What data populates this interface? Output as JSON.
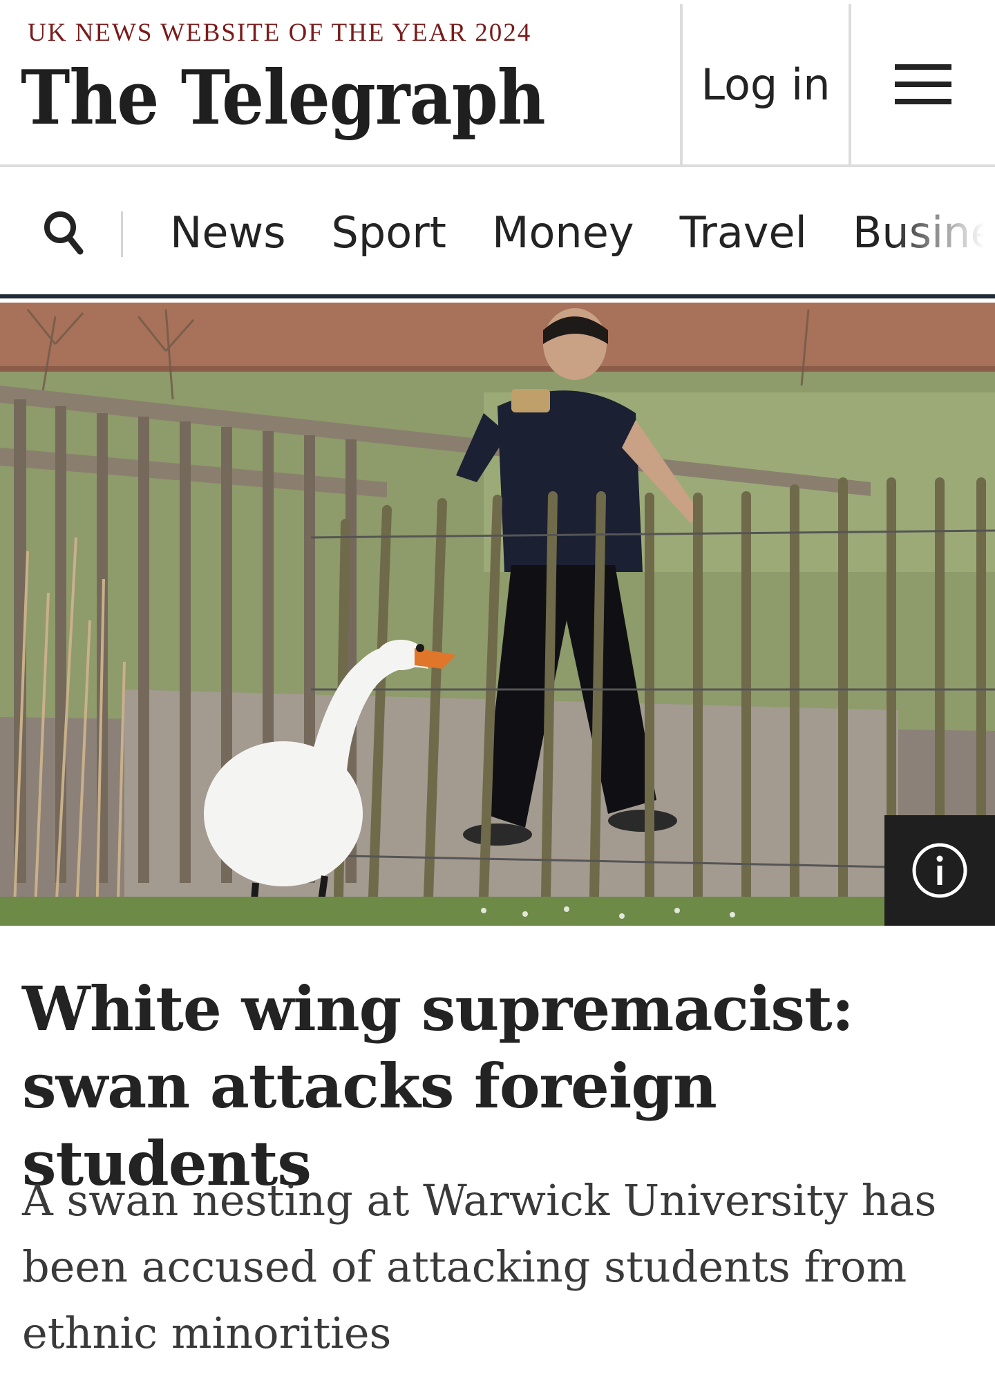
{
  "header": {
    "tagline": "UK NEWS WEBSITE OF THE YEAR 2024",
    "logo": "The Telegraph",
    "login_label": "Log in"
  },
  "nav": {
    "items": [
      "News",
      "Sport",
      "Money",
      "Travel",
      "Busine"
    ]
  },
  "article": {
    "headline": "White wing supremacist: swan attacks foreign students",
    "standfirst": "A swan nesting at Warwick University has been accused of attacking students from ethnic minorities"
  },
  "colors": {
    "tagline": "#7a1b1b",
    "text": "#232323",
    "nav_border": "#1f2a36",
    "info_box": "#1f1f1f"
  },
  "icons": {
    "search": "search-icon",
    "menu": "hamburger-menu-icon",
    "info": "info-icon"
  }
}
